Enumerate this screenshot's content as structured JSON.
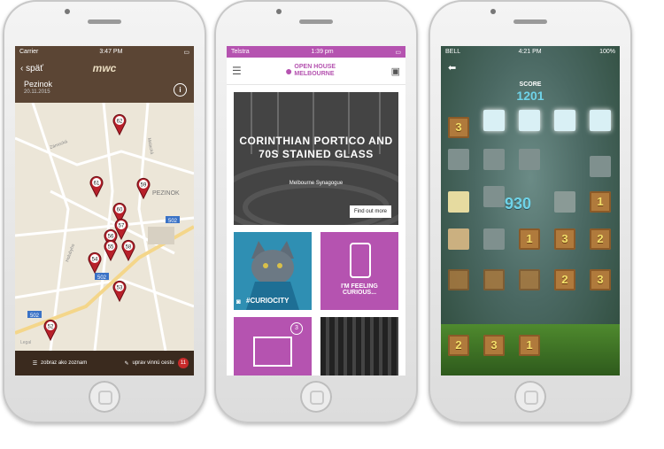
{
  "phone1": {
    "status": {
      "carrier": "Carrier",
      "time": "3:47 PM"
    },
    "nav": {
      "back_label": "späť",
      "logo": "mwc"
    },
    "place": {
      "name": "Pezinok",
      "date": "20.11.2015"
    },
    "info_label": "i",
    "map": {
      "town_label": "PEZINOK",
      "road_labels": [
        "502",
        "502",
        "502"
      ],
      "street_labels": [
        "Zámocká",
        "Malacká",
        "Holubyho"
      ],
      "map_note": "Legal",
      "pins": [
        "62",
        "61",
        "59",
        "60",
        "57",
        "56",
        "55",
        "58",
        "54",
        "53",
        "52"
      ]
    },
    "footer": {
      "list_label": "zobraz ako zoznam",
      "edit_label": "uprav vinnú cestu",
      "badge_count": "11"
    }
  },
  "phone2": {
    "status": {
      "carrier": "Telstra",
      "time": "1:39 pm"
    },
    "logo": "OPEN HOUSE MELBOURNE",
    "hero": {
      "title": "CORINTHIAN PORTICO AND 70S STAINED GLASS",
      "subtitle": "Melbourne Synagogue",
      "button": "Find out more"
    },
    "tile_cat_label": "#CURIOCITY",
    "tile_pink_label": "I'M FEELING CURIOUS...",
    "map_badge": "3",
    "colors": {
      "brand": "#b553b0",
      "cat_bg": "#2f8fb3"
    }
  },
  "phone3": {
    "status": {
      "carrier": "BELL",
      "time": "4:21 PM",
      "battery": "100%"
    },
    "score_label": "SCORE",
    "score_value": "1201",
    "combo_value": "930",
    "board_numbers": [
      "3",
      "1",
      "1",
      "3",
      "2",
      "2",
      "3"
    ],
    "hand_tiles": [
      "2",
      "3",
      "1"
    ]
  }
}
